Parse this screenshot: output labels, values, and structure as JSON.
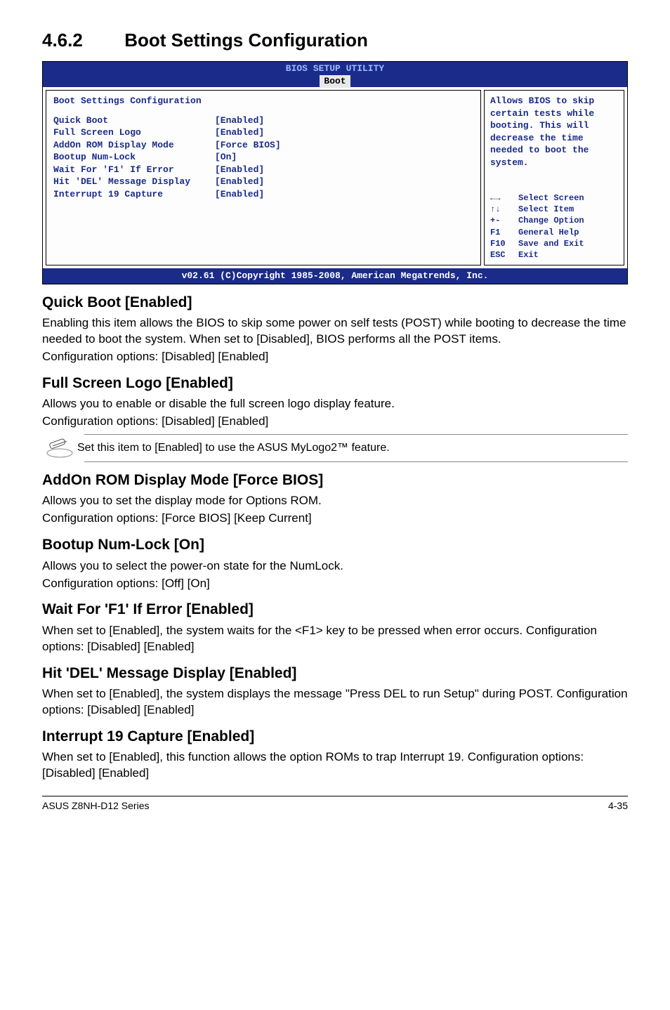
{
  "section": {
    "number": "4.6.2",
    "title": "Boot Settings Configuration"
  },
  "bios": {
    "header_title": "BIOS SETUP UTILITY",
    "tab": "Boot",
    "panel_title": "Boot Settings Configuration",
    "settings": [
      {
        "k": "Quick Boot",
        "v": "[Enabled]"
      },
      {
        "k": "Full Screen Logo",
        "v": "[Enabled]"
      },
      {
        "k": "AddOn ROM Display Mode",
        "v": "[Force BIOS]"
      },
      {
        "k": "Bootup Num-Lock",
        "v": "[On]"
      },
      {
        "k": "Wait For 'F1' If Error",
        "v": "[Enabled]"
      },
      {
        "k": "Hit 'DEL' Message Display",
        "v": "[Enabled]"
      },
      {
        "k": "Interrupt 19 Capture",
        "v": "[Enabled]"
      }
    ],
    "help_text": "Allows BIOS to skip certain tests while booting. This will decrease the time needed to boot the system.",
    "nav": [
      {
        "key": "←→",
        "label": "Select Screen"
      },
      {
        "key": "↑↓",
        "label": "Select Item"
      },
      {
        "key": "+-",
        "label": "Change Option"
      },
      {
        "key": "F1",
        "label": "General Help"
      },
      {
        "key": "F10",
        "label": "Save and Exit"
      },
      {
        "key": "ESC",
        "label": "Exit"
      }
    ],
    "footer": "v02.61 (C)Copyright 1985-2008, American Megatrends, Inc."
  },
  "sections": {
    "quick_boot": {
      "heading": "Quick Boot [Enabled]",
      "p1": "Enabling this item allows the BIOS to skip some power on self tests (POST) while booting to decrease the time needed to boot the system. When set to [Disabled], BIOS performs all the POST items.",
      "p2": "Configuration options: [Disabled] [Enabled]"
    },
    "full_screen_logo": {
      "heading": "Full Screen Logo [Enabled]",
      "p1": "Allows you to enable or disable the full screen logo display feature.",
      "p2": "Configuration options: [Disabled] [Enabled]",
      "note": "Set this item to [Enabled] to use the ASUS MyLogo2™ feature."
    },
    "addon_rom": {
      "heading": "AddOn ROM Display Mode [Force BIOS]",
      "p1": "Allows you to set the display mode for Options ROM.",
      "p2": "Configuration options: [Force BIOS] [Keep Current]"
    },
    "bootup_numlock": {
      "heading": "Bootup Num-Lock [On]",
      "p1": "Allows you to select the power-on state for the NumLock.",
      "p2": "Configuration options: [Off] [On]"
    },
    "wait_f1": {
      "heading": "Wait For 'F1' If Error [Enabled]",
      "p1": "When set to [Enabled], the system waits for the <F1> key to be pressed when error occurs. Configuration options: [Disabled] [Enabled]"
    },
    "hit_del": {
      "heading": "Hit 'DEL' Message Display [Enabled]",
      "p1": "When set to [Enabled], the system displays the message \"Press DEL to run Setup\" during POST. Configuration options: [Disabled] [Enabled]"
    },
    "interrupt19": {
      "heading": "Interrupt 19 Capture [Enabled]",
      "p1": "When set to [Enabled], this function allows the option ROMs to trap Interrupt 19. Configuration options: [Disabled] [Enabled]"
    }
  },
  "footer": {
    "left": "ASUS Z8NH-D12 Series",
    "right": "4-35"
  }
}
